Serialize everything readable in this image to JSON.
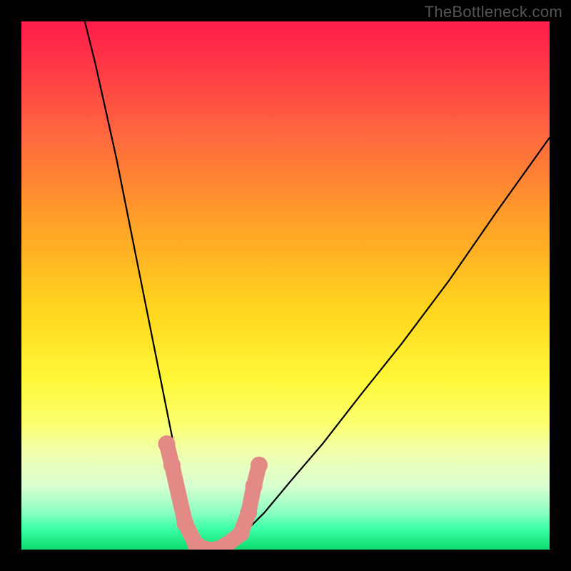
{
  "watermark": "TheBottleneck.com",
  "chart_data": {
    "type": "line",
    "title": "",
    "xlabel": "",
    "ylabel": "",
    "xlim": [
      0,
      100
    ],
    "ylim": [
      0,
      100
    ],
    "grid": false,
    "legend": false,
    "annotations": [],
    "gradient_meaning": "top red = high bottleneck, bottom green = low bottleneck",
    "series": [
      {
        "name": "bottleneck-curve",
        "x": [
          12,
          14,
          16,
          18,
          20,
          22,
          24,
          26,
          28,
          30,
          31.5,
          33,
          35,
          37,
          39,
          42,
          46,
          51,
          57,
          64,
          72,
          81,
          90,
          100
        ],
        "y": [
          100,
          92,
          83,
          74,
          64,
          54,
          44,
          34,
          24,
          14,
          7,
          2,
          0,
          0,
          1,
          3,
          7,
          13,
          20,
          29,
          39,
          51,
          64,
          78
        ]
      }
    ],
    "markers": [
      {
        "x": 27.5,
        "y": 20
      },
      {
        "x": 28.5,
        "y": 16
      },
      {
        "x": 31,
        "y": 5
      },
      {
        "x": 33,
        "y": 1
      },
      {
        "x": 35,
        "y": 0
      },
      {
        "x": 37,
        "y": 0
      },
      {
        "x": 39,
        "y": 1
      },
      {
        "x": 41.5,
        "y": 3
      },
      {
        "x": 43,
        "y": 7
      },
      {
        "x": 44,
        "y": 12
      },
      {
        "x": 45,
        "y": 16
      }
    ],
    "marker_style": {
      "color": "#e38a87",
      "radius_px": 12
    }
  }
}
